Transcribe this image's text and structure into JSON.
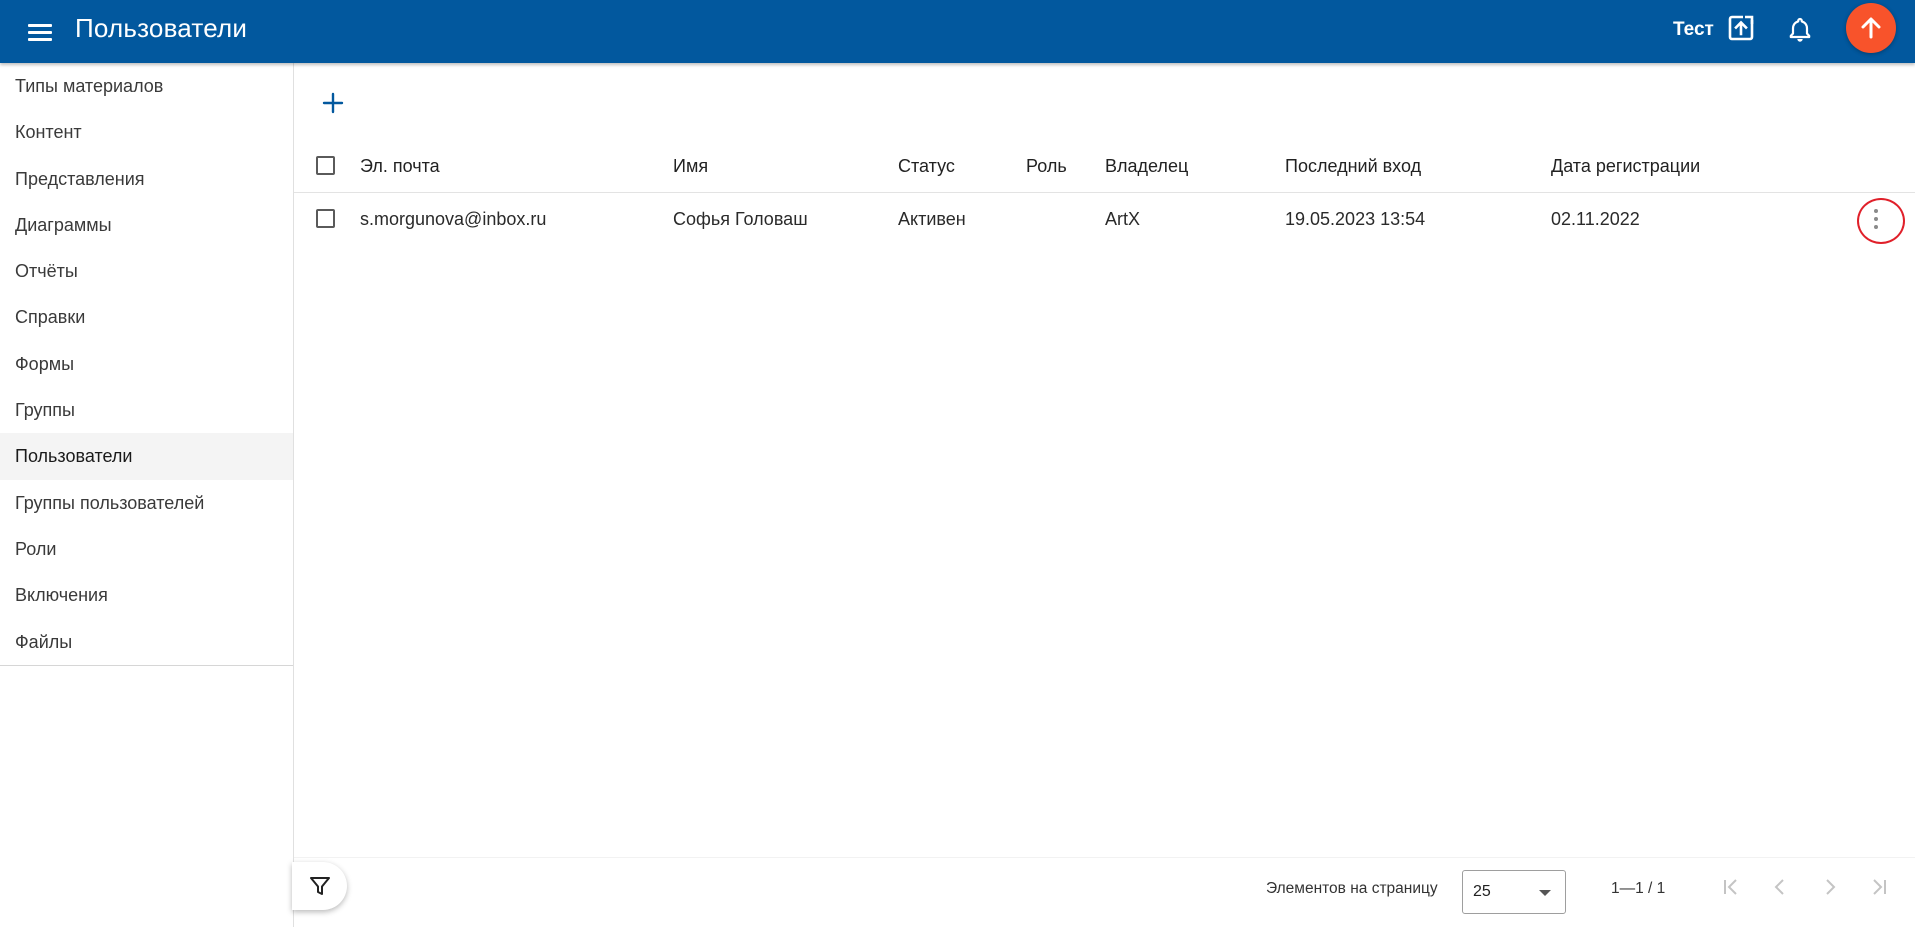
{
  "topbar": {
    "title": "Пользователи",
    "user_name": "Тест",
    "accent_color": "#02589e",
    "fab_color": "#f8532b",
    "icons": [
      "menu-icon",
      "logout-icon",
      "bell-icon",
      "arrow-up-icon"
    ]
  },
  "sidebar": {
    "items": [
      {
        "label": "Типы материалов"
      },
      {
        "label": "Контент"
      },
      {
        "label": "Представления"
      },
      {
        "label": "Диаграммы"
      },
      {
        "label": "Отчёты"
      },
      {
        "label": "Справки"
      },
      {
        "label": "Формы"
      },
      {
        "label": "Группы"
      },
      {
        "label": "Пользователи",
        "active": true
      },
      {
        "label": "Группы пользователей"
      },
      {
        "label": "Роли"
      },
      {
        "label": "Включения"
      },
      {
        "label": "Файлы"
      }
    ]
  },
  "table": {
    "headers": {
      "email": "Эл. почта",
      "name": "Имя",
      "status": "Статус",
      "role": "Роль",
      "owner": "Владелец",
      "last_login": "Последний вход",
      "registered": "Дата регистрации"
    },
    "rows": [
      {
        "email": "s.morgunova@inbox.ru",
        "name": "Софья Головаш",
        "status": "Активен",
        "role": "",
        "owner": "ArtX",
        "last_login": "19.05.2023 13:54",
        "registered": "02.11.2022"
      }
    ]
  },
  "footer": {
    "per_page_label": "Элементов на страницу",
    "per_page_value": "25",
    "range_label": "1—1 / 1"
  }
}
